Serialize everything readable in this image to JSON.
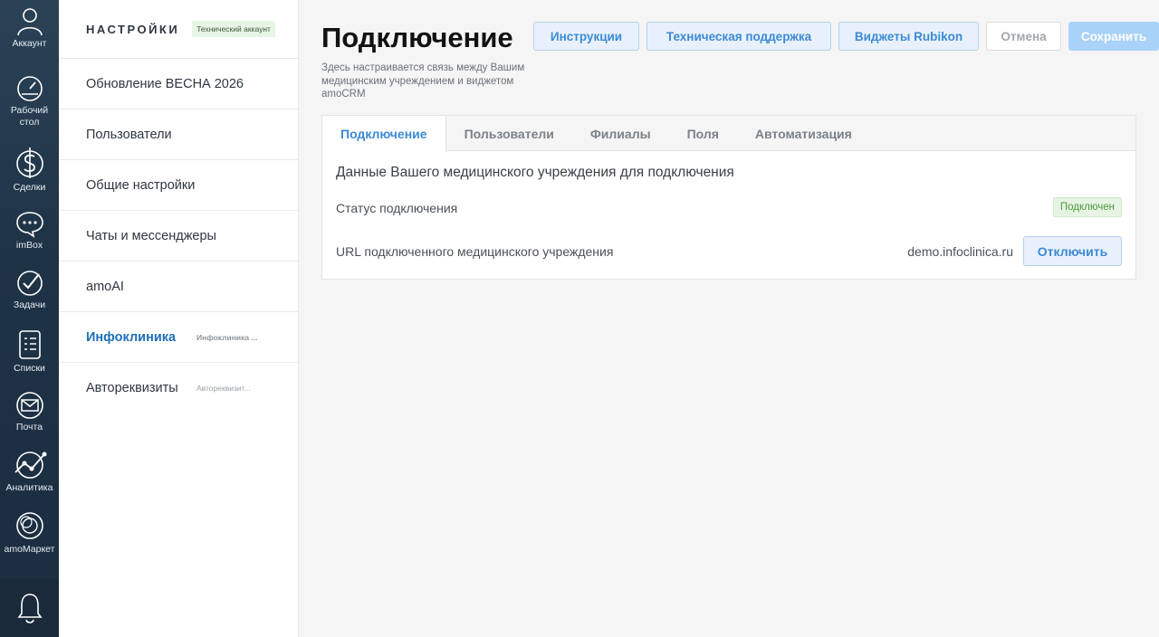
{
  "leftnav": {
    "items": [
      {
        "label": "Аккаунт",
        "icon": "account-icon"
      },
      {
        "label": "Рабочий стол",
        "icon": "dashboard-icon"
      },
      {
        "label": "Сделки",
        "icon": "dollar-icon"
      },
      {
        "label": "imBox",
        "icon": "chat-icon"
      },
      {
        "label": "Задачи",
        "icon": "check-icon"
      },
      {
        "label": "Списки",
        "icon": "list-icon"
      },
      {
        "label": "Почта",
        "icon": "mail-icon"
      },
      {
        "label": "Аналитика",
        "icon": "analytics-icon"
      },
      {
        "label": "amoМаркет",
        "icon": "market-icon"
      }
    ],
    "bottom_icon": "bell-icon"
  },
  "settings": {
    "title": "НАСТРОЙКИ",
    "badge": "Технический аккаунт",
    "items": [
      {
        "label": "Обновление ВЕСНА 2026",
        "sub": ""
      },
      {
        "label": "Пользователи",
        "sub": ""
      },
      {
        "label": "Общие настройки",
        "sub": ""
      },
      {
        "label": "Чаты и мессенджеры",
        "sub": ""
      },
      {
        "label": "amoAI",
        "sub": ""
      },
      {
        "label": "Инфоклиника",
        "sub": "Инфоклиника ..."
      },
      {
        "label": "Автореквизиты",
        "sub": "Автореквизит..."
      }
    ]
  },
  "header": {
    "title": "Подключение",
    "description": "Здесь настраивается связь между Вашим медицинским учреждением и виджетом amoCRM",
    "buttons": {
      "instructions": "Инструкции",
      "support": "Техническая поддержка",
      "widgets": "Виджеты Rubikon",
      "cancel": "Отмена",
      "save": "Сохранить"
    }
  },
  "tabs": [
    "Подключение",
    "Пользователи",
    "Филиалы",
    "Поля",
    "Автоматизация"
  ],
  "connection": {
    "section_title": "Данные Вашего медицинского учреждения для подключения",
    "status_label": "Статус подключения",
    "status_value": "Подключен",
    "url_label": "URL подключенного медицинского учреждения",
    "url_value": "demo.infoclinica.ru",
    "disconnect": "Отключить"
  }
}
